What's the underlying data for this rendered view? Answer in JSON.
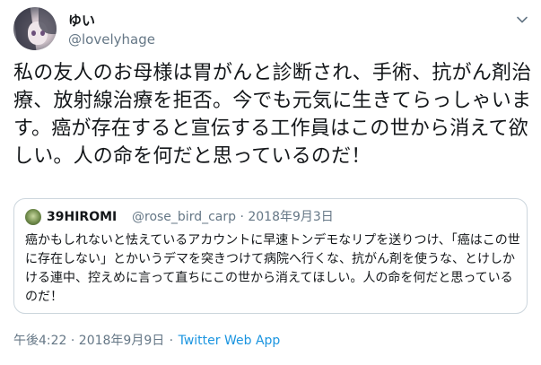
{
  "user": {
    "display_name": "ゆい",
    "screen_name": "@lovelyhage"
  },
  "tweet": {
    "text": "私の友人のお母様は胃がんと診断され、手術、抗がん剤治療、放射線治療を拒否。今でも元気に生きてらっしゃいます。癌が存在すると宣伝する工作員はこの世から消えて欲しい。人の命を何だと思っているのだ！"
  },
  "quoted_tweet": {
    "display_name": "39HIROMI",
    "handle_and_date": "@rose_bird_carp · 2018年9月3日",
    "text": "癌かもしれないと怯えているアカウントに早速トンデモなリプを送りつけ、「癌はこの世に存在しない」とかいうデマを突きつけて病院へ行くな、抗がん剤を使うな、とけしかける連中、控えめに言って直ちにこの世から消えてほしい。人の命を何だと思っているのだ！"
  },
  "footer": {
    "timestamp": "午後4:22 · 2018年9月9日",
    "separator": " · ",
    "source": "Twitter Web App"
  },
  "icons": {
    "menu": "chevron-down-icon"
  },
  "colors": {
    "text": "#14171a",
    "secondary": "#657786",
    "link": "#1b95e0",
    "border": "#ccd6dd"
  }
}
